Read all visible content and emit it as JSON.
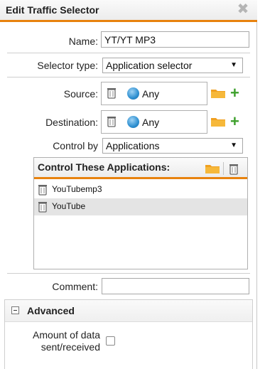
{
  "dialog": {
    "title": "Edit Traffic Selector",
    "close_glyph": "✖"
  },
  "form": {
    "name_label": "Name:",
    "name_value": "YT/YT MP3",
    "selector_type_label": "Selector type:",
    "selector_type_value": "Application selector",
    "source_label": "Source:",
    "source_value": "Any",
    "destination_label": "Destination:",
    "destination_value": "Any",
    "control_by_label": "Control by",
    "control_by_value": "Applications",
    "comment_label": "Comment:",
    "comment_value": ""
  },
  "applications_panel": {
    "title": "Control These Applications:",
    "items": [
      {
        "label": "YouTubemp3",
        "selected": false
      },
      {
        "label": "YouTube",
        "selected": true
      }
    ]
  },
  "advanced": {
    "title": "Advanced",
    "amount_label_line1": "Amount of data",
    "amount_label_line2": "sent/received",
    "amount_checked": false
  },
  "colors": {
    "accent": "#e8820e",
    "plus_green": "#3ea02c",
    "globe_blue": "#2d8fd0",
    "selected_row": "#e4e4e4"
  },
  "icons": [
    "close-icon",
    "trash-icon",
    "globe-icon",
    "folder-icon",
    "plus-icon",
    "dropdown-arrow-icon",
    "collapse-icon"
  ]
}
